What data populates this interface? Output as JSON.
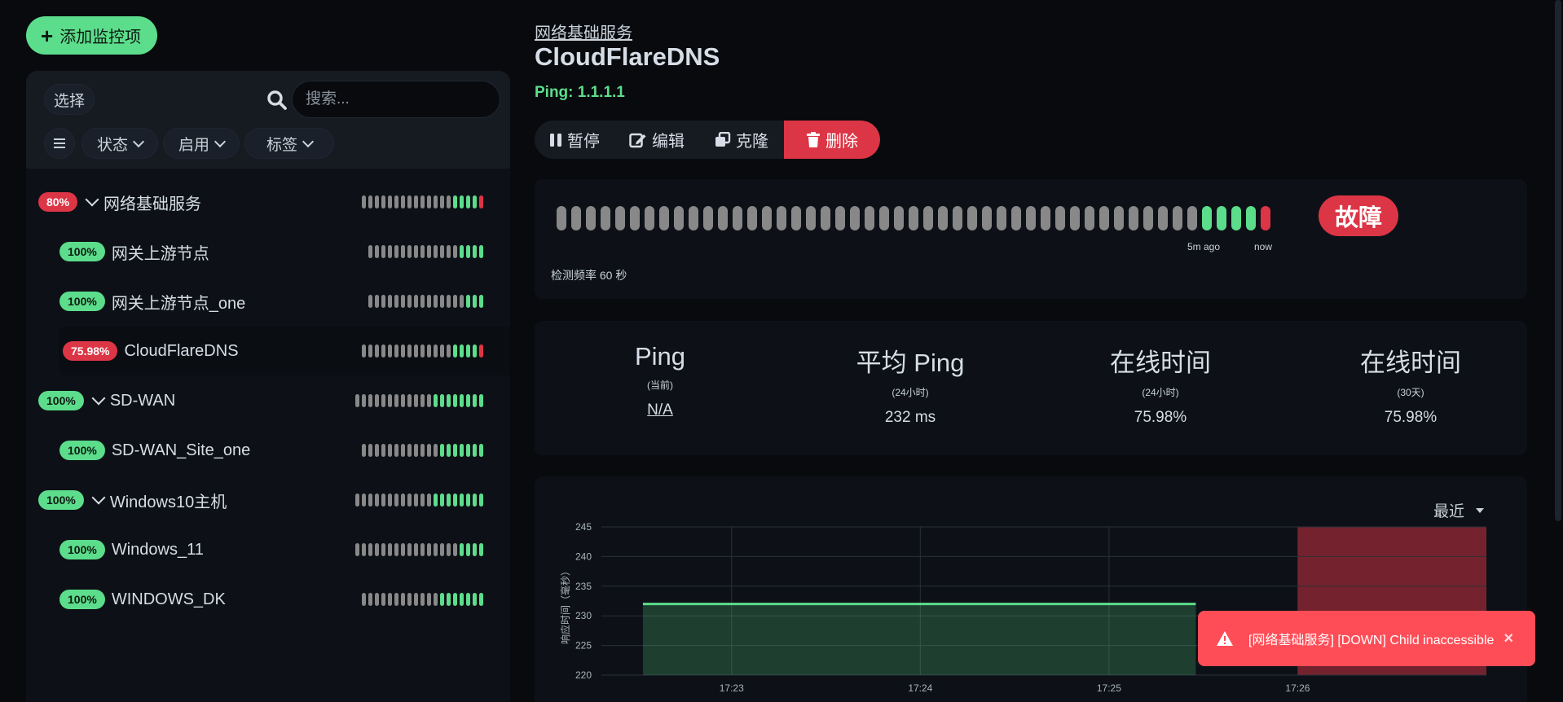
{
  "add_button": {
    "label": "添加监控项"
  },
  "sidebar": {
    "select_label": "选择",
    "search_placeholder": "搜索...",
    "filters": [
      {
        "label": "状态"
      },
      {
        "label": "启用"
      },
      {
        "label": "标签"
      }
    ],
    "items": [
      {
        "name": "网络基础服务",
        "uptime": "80%",
        "status": "down",
        "group": true,
        "beats": "gggggggggggggguuuud"
      },
      {
        "name": "网关上游节点",
        "uptime": "100%",
        "status": "up",
        "group": false,
        "beats": "gggggggggggggguuuu"
      },
      {
        "name": "网关上游节点_one",
        "uptime": "100%",
        "status": "up",
        "group": false,
        "beats": "ggggggggggggggguuu"
      },
      {
        "name": "CloudFlareDNS",
        "uptime": "75.98%",
        "status": "down",
        "group": false,
        "selected": true,
        "beats": "gggggggggggggguuuud"
      },
      {
        "name": "SD-WAN",
        "uptime": "100%",
        "status": "up",
        "group": true,
        "beats": "gggggggggggguuuuuuuu"
      },
      {
        "name": "SD-WAN_Site_one",
        "uptime": "100%",
        "status": "up",
        "group": false,
        "beats": "gggggggggggguuuuuuu"
      },
      {
        "name": "Windows10主机",
        "uptime": "100%",
        "status": "up",
        "group": true,
        "beats": "gggggggggggguuuuuuuu"
      },
      {
        "name": "Windows_11",
        "uptime": "100%",
        "status": "up",
        "group": false,
        "beats": "gggggggggggggggguuuu"
      },
      {
        "name": "WINDOWS_DK",
        "uptime": "100%",
        "status": "up",
        "group": false,
        "beats": "gggggggggggguuuuuuu"
      }
    ]
  },
  "monitor": {
    "breadcrumb": "网络基础服务",
    "title": "CloudFlareDNS",
    "ping_url": "Ping: 1.1.1.1",
    "actions": {
      "pause": "暂停",
      "edit": "编辑",
      "clone": "克隆",
      "delete": "删除"
    },
    "heartbeat": {
      "beats": "gggggggggggggggggggggggggggggggggggggggggggguuuud",
      "label_5m": "5m ago",
      "label_now": "now",
      "frequency": "检测频率 60 秒",
      "status": "故障"
    },
    "stats": [
      {
        "title": "Ping",
        "sub": "(当前)",
        "value": "N/A"
      },
      {
        "title": "平均 Ping",
        "sub": "(24小时)",
        "value": "232 ms"
      },
      {
        "title": "在线时间",
        "sub": "(24小时)",
        "value": "75.98%"
      },
      {
        "title": "在线时间",
        "sub": "(30天)",
        "value": "75.98%"
      }
    ],
    "period": "最近"
  },
  "colors": {
    "up": "#5cdd8b",
    "down": "#dc3545",
    "empty": "#888888"
  },
  "chart_data": {
    "type": "area",
    "ylabel": "响应时间（毫秒）",
    "ylim": [
      220,
      245
    ],
    "yticks": [
      220,
      225,
      230,
      235,
      240,
      245
    ],
    "x_ticks": [
      "17:23",
      "17:24",
      "17:25",
      "17:26"
    ],
    "x_domain_minutes": [
      22.31,
      27.0
    ],
    "series": [
      {
        "x_minutes": [
          22.53,
          25.46
        ],
        "values": [
          232,
          232
        ]
      }
    ],
    "down_region_minutes": [
      26.0,
      27.0
    ],
    "grid": true
  },
  "toast": {
    "message": "[网络基础服务] [DOWN] Child inaccessible",
    "close": "×"
  }
}
